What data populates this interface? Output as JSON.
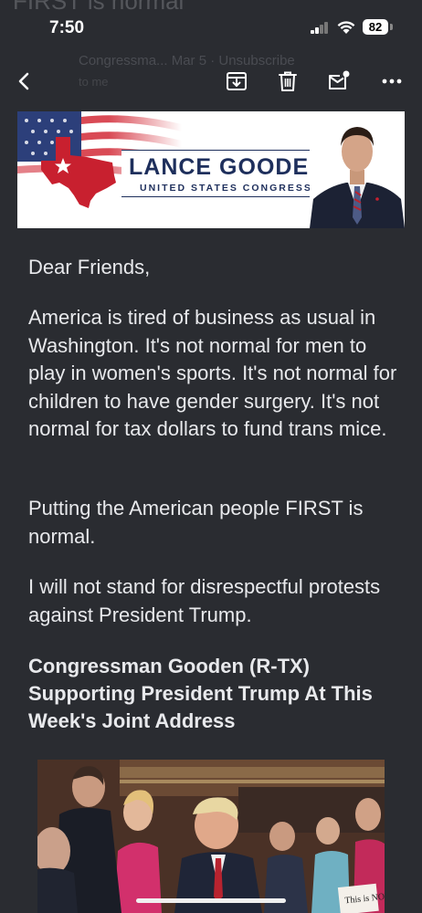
{
  "status_bar": {
    "time": "7:50",
    "battery": "82",
    "ghost_title": "FIRST is normal"
  },
  "toolbar": {
    "ghost_sender": "Congressma... Mar 5 · Unsubscribe",
    "ghost_subtitle": "to me"
  },
  "banner": {
    "name": "LANCE GOODEN",
    "title": "UNITED STATES CONGRESSMAN"
  },
  "email": {
    "greeting": "Dear Friends,",
    "para1": "America is tired of business as usual in Washington. It's not normal for men to play in women's sports. It's not normal for children to have gender surgery. It's not normal for tax dollars to fund trans mice.",
    "para2": "Putting the American people FIRST is normal.",
    "para3": "I will not stand for disrespectful protests against President Trump.",
    "heading": "Congressman Gooden (R-TX) Supporting President Trump At This Week's Joint Address"
  },
  "photo": {
    "sign_text": "This is NOT"
  },
  "colors": {
    "background": "#2a2c31",
    "banner_navy": "#1e2f5c",
    "texas_red": "#c8202f"
  }
}
